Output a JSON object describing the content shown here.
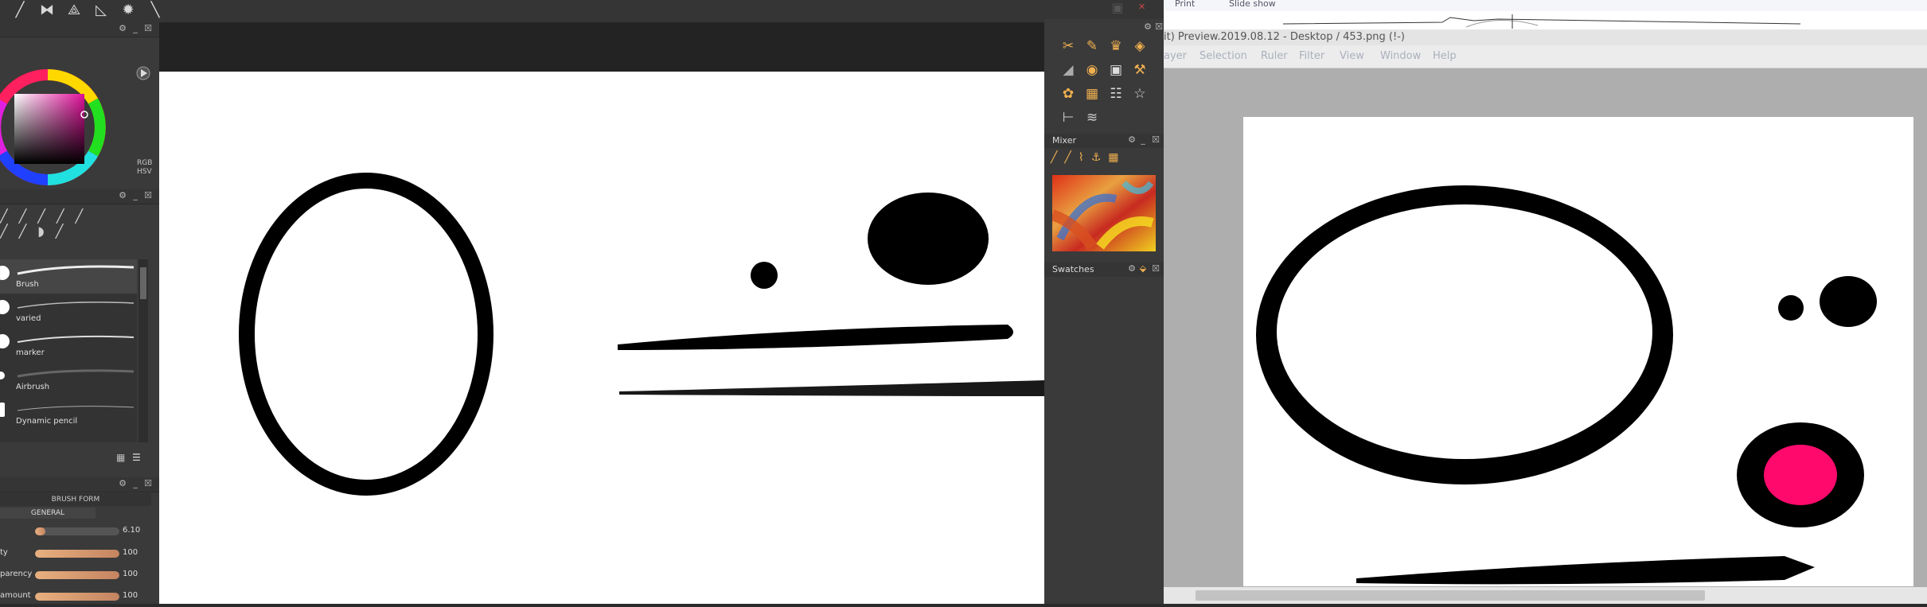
{
  "painter": {
    "toolbar": {
      "icons": [
        "brush-icon",
        "mirror-icon",
        "wrap-icon",
        "ruler-icon",
        "gear-icon",
        "pen-icon"
      ]
    },
    "color_panel": {
      "labels": [
        "RGB",
        "HSV"
      ]
    },
    "brush_presets": {
      "items": [
        {
          "label": "Brush"
        },
        {
          "label": "varied"
        },
        {
          "label": "marker"
        },
        {
          "label": "Airbrush"
        },
        {
          "label": "Dynamic pencil"
        }
      ]
    },
    "brush_settings": {
      "header": "BRUSH FORM",
      "section": "GENERAL",
      "sliders": [
        {
          "label": "",
          "value": "6.10",
          "fraction": 0.12
        },
        {
          "label": "ty",
          "value": "100",
          "fraction": 1.0
        },
        {
          "label": "parency",
          "value": "100",
          "fraction": 1.0
        },
        {
          "label": "amount",
          "value": "100",
          "fraction": 1.0
        }
      ]
    },
    "mixer": {
      "title": "Mixer"
    },
    "swatches": {
      "title": "Swatches"
    }
  },
  "preview": {
    "top_items": [
      "Print",
      "Slide show"
    ],
    "title": "it) Preview.2019.08.12 - Desktop / 453.png (!-)",
    "menu": [
      "ayer",
      "Selection",
      "Ruler",
      "Filter",
      "View",
      "Window",
      "Help"
    ]
  },
  "colors": {
    "accent_pink": "#ff0a6c",
    "ink": "#000000"
  }
}
